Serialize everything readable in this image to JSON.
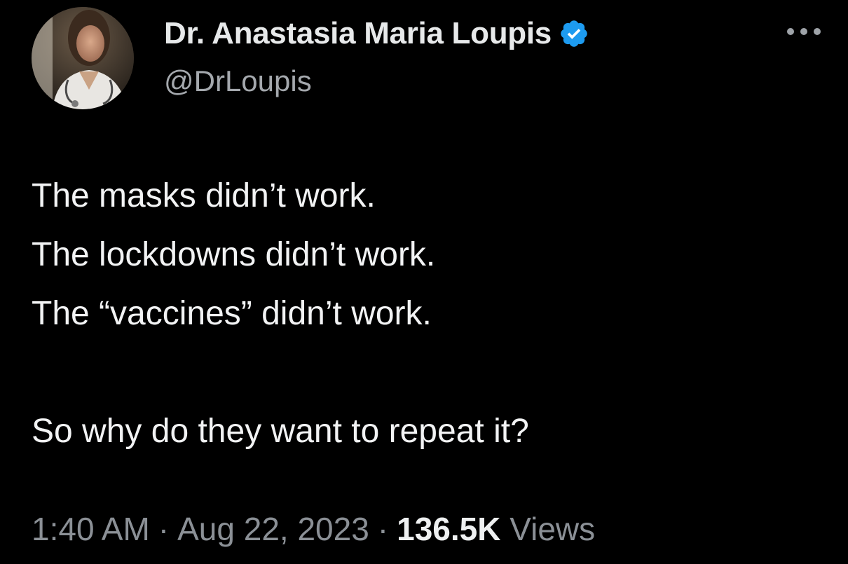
{
  "author": {
    "display_name": "Dr. Anastasia Maria Loupis",
    "handle": "@DrLoupis",
    "verified_icon": "verified-badge-icon",
    "verified_color": "#1d9bf0"
  },
  "more_icon": "more-options-icon",
  "tweet": {
    "lines": [
      "The masks didn’t work.",
      "The lockdowns didn’t work.",
      "The “vaccines” didn’t work.",
      "",
      "So why do they want to repeat it?"
    ]
  },
  "meta": {
    "time": "1:40 AM",
    "separator": "·",
    "date": "Aug 22, 2023",
    "views_count": "136.5K",
    "views_label": "Views"
  },
  "colors": {
    "background": "#000000",
    "primary_text": "#e7e9ea",
    "secondary_text": "#8b9096"
  }
}
